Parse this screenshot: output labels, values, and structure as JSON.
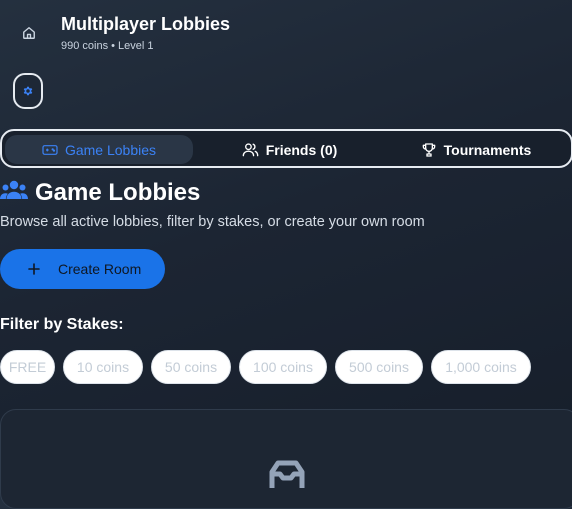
{
  "header": {
    "title": "Multiplayer Lobbies",
    "subtitle": "990 coins • Level 1",
    "home_icon": "home-icon",
    "settings_icon": "gear-icon"
  },
  "tabs": [
    {
      "label": "Game Lobbies",
      "icon": "gamepad-icon",
      "active": true
    },
    {
      "label": "Friends (0)",
      "icon": "users-icon",
      "active": false
    },
    {
      "label": "Tournaments",
      "icon": "trophy-icon",
      "active": false
    }
  ],
  "main": {
    "title": "Game Lobbies",
    "title_icon": "users-group-icon",
    "description": "Browse all active lobbies, filter by stakes, or create your own room",
    "create_button": "Create Room",
    "filter_label": "Filter by Stakes:",
    "stakes": [
      "FREE",
      "10 coins",
      "50 coins",
      "100 coins",
      "500 coins",
      "1,000 coins"
    ],
    "empty_icon": "inbox-icon"
  },
  "colors": {
    "accent": "#3b82f6",
    "primary_button": "#1a73e8",
    "background": "#1c2533"
  }
}
